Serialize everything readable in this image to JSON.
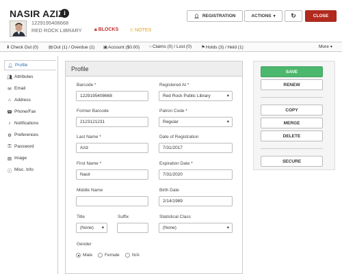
{
  "header": {
    "name": "NASIR AZIZ",
    "barcode": "1229195408668",
    "library": "RED ROCK LIBRARY",
    "blocks": "BLOCKS",
    "notes": "NOTES",
    "buttons": {
      "registration": "REGISTRATION",
      "actions": "ACTIONS",
      "close": "CLOSE"
    }
  },
  "tabs": [
    {
      "label": "Check Out (0)",
      "icon": "checkout-icon"
    },
    {
      "label": "Out (1) / Overdue (1)",
      "icon": "book-icon"
    },
    {
      "label": "Account ($0.00)",
      "icon": "money-icon"
    },
    {
      "label": "Claims (0) / Lost (0)",
      "icon": "claims-icon"
    },
    {
      "label": "Holds (3) / Held (1)",
      "icon": "flag-icon"
    },
    {
      "label": "More",
      "icon": "caret-down-icon"
    }
  ],
  "sidebar": {
    "items": [
      {
        "label": "Profile",
        "icon": "user-icon"
      },
      {
        "label": "Attributes",
        "icon": "users-icon"
      },
      {
        "label": "Email",
        "icon": "envelope-icon"
      },
      {
        "label": "Address",
        "icon": "home-icon"
      },
      {
        "label": "Phone/Fax",
        "icon": "phone-icon"
      },
      {
        "label": "Notifications",
        "icon": "bell-icon"
      },
      {
        "label": "Preferences",
        "icon": "cogs-icon"
      },
      {
        "label": "Password",
        "icon": "key-icon"
      },
      {
        "label": "Image",
        "icon": "image-icon"
      },
      {
        "label": "Misc. Info",
        "icon": "info-icon"
      }
    ]
  },
  "profile": {
    "title": "Profile",
    "barcode_label": "Barcode *",
    "barcode": "1229195408668",
    "registered_at_label": "Registered At *",
    "registered_at": "Red Rock Public Library",
    "former_barcode_label": "Former Barcode",
    "former_barcode": "2123121231",
    "patron_code_label": "Patron Code *",
    "patron_code": "Regular",
    "last_name_label": "Last Name *",
    "last_name": "Aziz",
    "date_registration_label": "Date of Registration",
    "date_registration": "7/31/2017",
    "first_name_label": "First Name *",
    "first_name": "Nasir",
    "expiration_label": "Expiration Date *",
    "expiration": "7/31/2020",
    "middle_name_label": "Middle Name",
    "middle_name": "",
    "birth_date_label": "Birth Date",
    "birth_date": "2/14/1989",
    "title_label": "Title",
    "title_value": "(None)",
    "suffix_label": "Suffix",
    "suffix": "",
    "statistical_class_label": "Statistical Class",
    "statistical_class": "(None)",
    "gender_label": "Gender",
    "gender_options": [
      "Male",
      "Female",
      "N/A"
    ],
    "gender_selected": "Male"
  },
  "actions": {
    "save": "SAVE",
    "renew": "RENEW",
    "copy": "COPY",
    "merge": "MERGE",
    "delete": "DELETE",
    "secure": "SECURE"
  },
  "colors": {
    "close": "#b22a1e",
    "save": "#4cb86d",
    "blocks": "#c0302b",
    "notes": "#e0a020",
    "active_nav": "#2a6fb0"
  }
}
